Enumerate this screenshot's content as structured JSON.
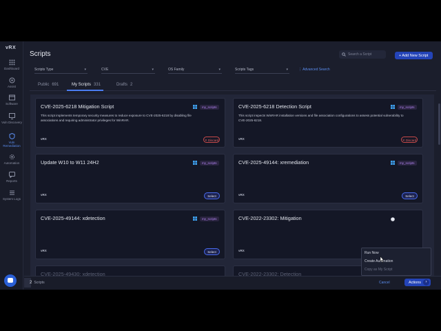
{
  "app": {
    "logo": "vRX"
  },
  "sidebar": {
    "items": [
      {
        "label": "Dashboard",
        "icon": "grid-icon"
      },
      {
        "label": "Assist",
        "icon": "target-icon"
      },
      {
        "label": "Software",
        "icon": "window-icon"
      },
      {
        "label": "Vuln Discovery",
        "icon": "monitor-search-icon"
      },
      {
        "label": "Vuln Remediation",
        "icon": "shield-icon"
      },
      {
        "label": "Automation",
        "icon": "gear-icon"
      },
      {
        "label": "Reports",
        "icon": "chat-report-icon"
      },
      {
        "label": "System Logs",
        "icon": "list-icon"
      }
    ]
  },
  "header": {
    "title": "Scripts",
    "search_placeholder": "Search a Script",
    "add_label": "+ Add New Script"
  },
  "filters": [
    {
      "label": "Scripts Type"
    },
    {
      "label": "CVE"
    },
    {
      "label": "OS Family"
    },
    {
      "label": "Scripts Tags"
    }
  ],
  "advanced_search": "Advanced Search",
  "tabs": [
    {
      "label": "Public",
      "count": "691"
    },
    {
      "label": "My Scripts",
      "count": "331"
    },
    {
      "label": "Drafts",
      "count": "2"
    }
  ],
  "cards": [
    {
      "title": "CVE-2025-6218 Mitigation Script",
      "desc": "This script implements temporary security measures to reduce exposure to CVE-2025-6218 by disabling file associations and requiring administrator privileges for WinRAR.",
      "tag": "my_scripts",
      "vendor": "vRX",
      "action": "Discard"
    },
    {
      "title": "CVE-2025-6218 Detection Script",
      "desc": "This script inspects WinRAR installation versions and file association configurations to assess potential vulnerability to CVE-2025-6218.",
      "tag": "my_scripts",
      "vendor": "vRX",
      "action": "Discard"
    },
    {
      "title": "Update W10 to W11 24H2",
      "desc": "",
      "tag": "my_scripts",
      "vendor": "vRX",
      "action": "Select"
    },
    {
      "title": "CVE-2025-49144: xremediation",
      "desc": "",
      "tag": "my_scripts",
      "vendor": "vRX",
      "action": "Select"
    },
    {
      "title": "CVE-2025-49144: xdetection",
      "desc": "",
      "tag": "my_scripts",
      "vendor": "vRX",
      "action": "Select"
    },
    {
      "title": "CVE-2022-23302: Mitigation",
      "desc": "",
      "tag": "",
      "vendor": "vRX",
      "action": ""
    }
  ],
  "partial_titles": [
    "CVE-2025-49430: xdetection",
    "CVE-2022-23302: Detection"
  ],
  "footer": {
    "count": "2",
    "count_label": "Scripts",
    "cancel": "Cancel",
    "actions": "Actions"
  },
  "context_menu": {
    "items": [
      "Run Now",
      "Create Automation",
      "Copy as My Script"
    ]
  },
  "colors": {
    "accent": "#2444b8",
    "tag": "#b083f0",
    "discard": "#e06262"
  }
}
